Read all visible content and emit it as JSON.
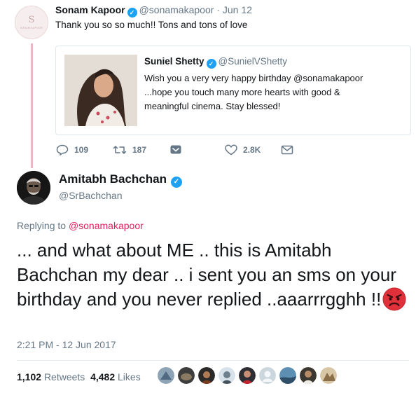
{
  "top_tweet": {
    "avatar_text": "S",
    "avatar_subtext": "SONAM KAPOOR",
    "name": "Sonam Kapoor",
    "handle": "@sonamakapoor",
    "date_separator": " · ",
    "date": "Jun 12",
    "text": "Thank you so so much!! Tons and tons of love"
  },
  "quoted_tweet": {
    "name": "Suniel Shetty",
    "handle": "@SunielVShetty",
    "lines": [
      "Wish you a very very happy birthday @sonamakapoor",
      "...hope you touch many more hearts with good &",
      "meaningful cinema. Stay blessed!"
    ]
  },
  "actions": {
    "replies": "109",
    "retweets": "187",
    "likes": "2.8K"
  },
  "main_tweet": {
    "name": "Amitabh Bachchan",
    "handle": "@SrBachchan",
    "replying_prefix": "Replying to ",
    "replying_to": "@sonamakapoor",
    "text": "... and what about ME .. this is Amitabh Bachchan my dear .. i sent you an sms on your birthday and you never replied ..aaarrrgghh !!",
    "timestamp": "2:21 PM - 12 Jun 2017",
    "retweets_count": "1,102",
    "retweets_label": "Retweets",
    "likes_count": "4,482",
    "likes_label": "Likes"
  },
  "colors": {
    "accent": "#1da1f2",
    "reply_link": "#e0245e",
    "thread_line": "#e8b9c4",
    "muted": "#657786"
  }
}
